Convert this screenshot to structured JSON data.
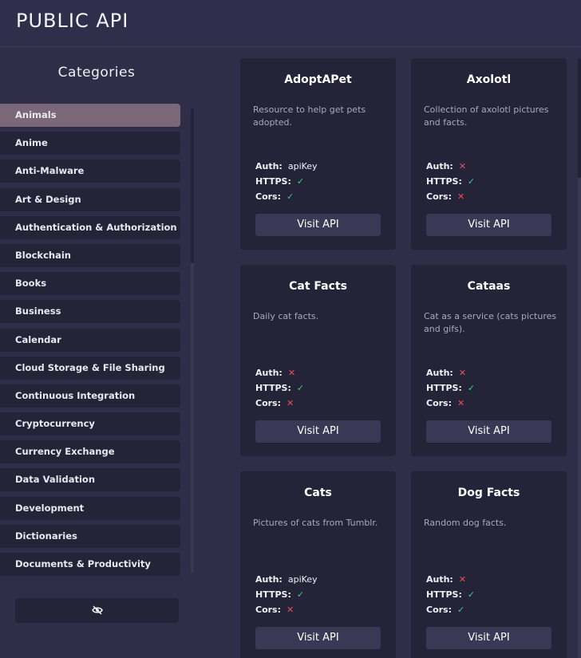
{
  "header": {
    "title": "PUBLIC API"
  },
  "sidebar": {
    "title": "Categories",
    "items": [
      "Animals",
      "Anime",
      "Anti-Malware",
      "Art & Design",
      "Authentication & Authorization",
      "Blockchain",
      "Books",
      "Business",
      "Calendar",
      "Cloud Storage & File Sharing",
      "Continuous Integration",
      "Cryptocurrency",
      "Currency Exchange",
      "Data Validation",
      "Development",
      "Dictionaries",
      "Documents & Productivity"
    ],
    "active_index": 0,
    "hide_button_icon": "eye-slash-icon"
  },
  "labels": {
    "auth": "Auth:",
    "https": "HTTPS:",
    "cors": "Cors:",
    "visit": "Visit API"
  },
  "cards": [
    {
      "name": "AdoptAPet",
      "description": "Resource to help get pets adopted.",
      "auth": "apiKey",
      "https": true,
      "cors": true
    },
    {
      "name": "Axolotl",
      "description": "Collection of axolotl pictures and facts.",
      "auth": null,
      "https": true,
      "cors": false
    },
    {
      "name": "Cat Facts",
      "description": "Daily cat facts.",
      "auth": null,
      "https": true,
      "cors": false
    },
    {
      "name": "Cataas",
      "description": "Cat as a service (cats pictures and gifs).",
      "auth": null,
      "https": true,
      "cors": false
    },
    {
      "name": "Cats",
      "description": "Pictures of cats from Tumblr.",
      "auth": "apiKey",
      "https": true,
      "cors": false
    },
    {
      "name": "Dog Facts",
      "description": "Random dog facts.",
      "auth": null,
      "https": true,
      "cors": true
    }
  ],
  "colors": {
    "accent_active": "#7a6878",
    "check": "#3fd07a",
    "cross": "#e4505a"
  },
  "icons": {
    "check": "✓",
    "cross": "✕"
  }
}
